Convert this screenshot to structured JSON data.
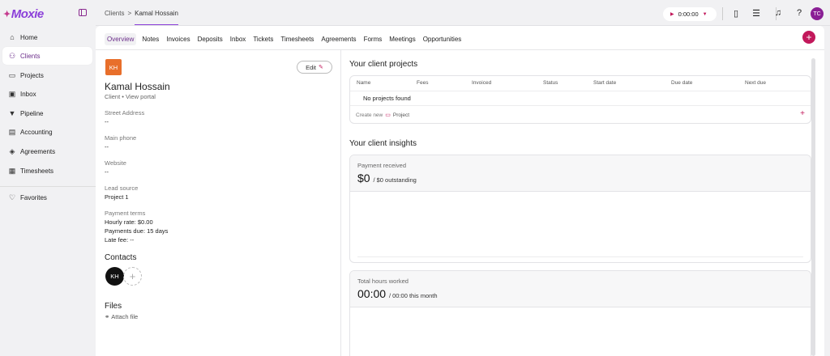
{
  "app": {
    "logo_text": "Moxie"
  },
  "sidebar": {
    "items": [
      {
        "label": "Home",
        "icon": "⌂",
        "active": false
      },
      {
        "label": "Clients",
        "icon": "👥",
        "active": true
      },
      {
        "label": "Projects",
        "icon": "▭",
        "active": false
      },
      {
        "label": "Inbox",
        "icon": "✉",
        "active": false
      },
      {
        "label": "Pipeline",
        "icon": "⧩",
        "active": false
      },
      {
        "label": "Accounting",
        "icon": "▤",
        "active": false
      },
      {
        "label": "Agreements",
        "icon": "✎",
        "active": false
      },
      {
        "label": "Timesheets",
        "icon": "▦",
        "active": false
      }
    ],
    "favorites_label": "Favorites"
  },
  "topbar": {
    "crumb_root": "Clients",
    "crumb_sep": ">",
    "crumb_current": "Kamal Hossain",
    "timer": "0:00:00",
    "user_initials": "TC"
  },
  "tabs": [
    "Overview",
    "Notes",
    "Invoices",
    "Deposits",
    "Inbox",
    "Tickets",
    "Timesheets",
    "Agreements",
    "Forms",
    "Meetings",
    "Opportunities"
  ],
  "client": {
    "initials": "KH",
    "name": "Kamal Hossain",
    "subtitle": "Client • View portal",
    "edit_label": "Edit",
    "fields": [
      {
        "label": "Street Address",
        "value": "--"
      },
      {
        "label": "Main phone",
        "value": "--"
      },
      {
        "label": "Website",
        "value": "--"
      },
      {
        "label": "Lead source",
        "value": "Project 1"
      }
    ],
    "payment_terms_label": "Payment terms",
    "payment_terms": [
      "Hourly rate: $0.00",
      "Payments due: 15 days",
      "Late fee: --"
    ],
    "contacts_label": "Contacts",
    "contact_initials": "KH",
    "files_label": "Files",
    "attach_label": "Attach file"
  },
  "projects": {
    "title": "Your client projects",
    "columns": [
      "Name",
      "Fees",
      "Invoiced",
      "Status",
      "Start date",
      "Due date",
      "Next due"
    ],
    "empty": "No projects found",
    "create_new": "Create new",
    "create_type": "Project"
  },
  "insights": {
    "title": "Your client insights",
    "payment_title": "Payment received",
    "payment_amount": "$0",
    "payment_sub": "/ $0 outstanding",
    "hours_title": "Total hours worked",
    "hours_amount": "00:00",
    "hours_sub": "/ 00:00 this month"
  }
}
